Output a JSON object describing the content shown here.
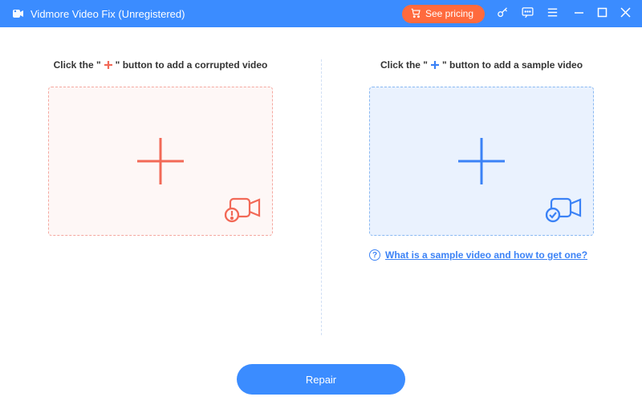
{
  "app": {
    "title": "Vidmore Video Fix (Unregistered)"
  },
  "titlebar": {
    "pricing_label": "See pricing"
  },
  "panels": {
    "left": {
      "instruction_pre": "Click the \"",
      "instruction_post": "\" button to add a corrupted video"
    },
    "right": {
      "instruction_pre": "Click the \"",
      "instruction_post": "\" button to add a sample video",
      "help_link": "What is a sample video and how to get one?"
    }
  },
  "actions": {
    "repair_label": "Repair"
  },
  "colors": {
    "accent_blue": "#3b8cff",
    "corrupt_red": "#f26957",
    "sample_blue": "#3b82f6",
    "pricing_orange": "#ff6a3d"
  }
}
